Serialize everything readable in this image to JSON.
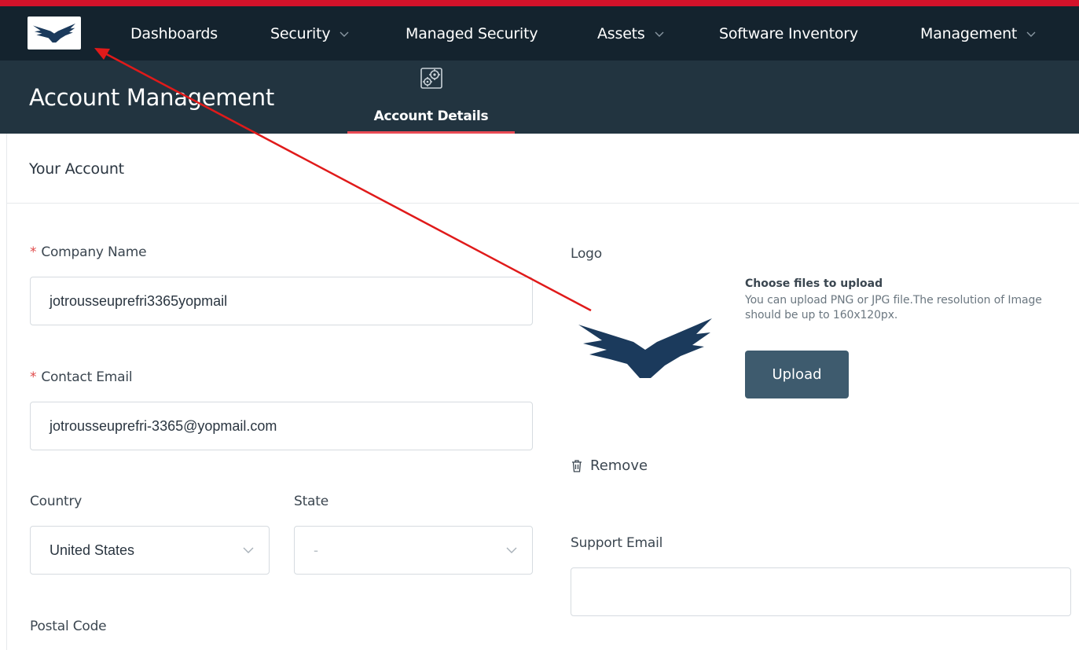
{
  "nav": {
    "items": [
      {
        "label": "Dashboards",
        "dropdown": false
      },
      {
        "label": "Security",
        "dropdown": true
      },
      {
        "label": "Managed Security",
        "dropdown": false
      },
      {
        "label": "Assets",
        "dropdown": true
      },
      {
        "label": "Software Inventory",
        "dropdown": false
      },
      {
        "label": "Management",
        "dropdown": true
      }
    ],
    "logo_icon": "eagle-logo-icon"
  },
  "subheader": {
    "title": "Account Management",
    "tab_label": "Account Details",
    "tab_icon": "settings-gears-icon"
  },
  "section": {
    "title": "Your Account"
  },
  "form": {
    "company_name": {
      "label": "Company Name",
      "required_mark": "*",
      "value": "jotrousseuprefri3365yopmail"
    },
    "contact_email": {
      "label": "Contact Email",
      "required_mark": "*",
      "value": "jotrousseuprefri-3365@yopmail.com"
    },
    "country": {
      "label": "Country",
      "value": "United States"
    },
    "state": {
      "label": "State",
      "value": "-"
    },
    "postal_code": {
      "label": "Postal Code"
    },
    "logo": {
      "label": "Logo"
    },
    "upload": {
      "title": "Choose files to upload",
      "description": "You can upload PNG or JPG file.The resolution of Image should be up to 160x120px.",
      "button_label": "Upload"
    },
    "remove_label": "Remove",
    "support_email": {
      "label": "Support Email",
      "value": ""
    }
  },
  "colors": {
    "accent_red": "#d3122a",
    "nav_bg": "#14232e",
    "subheader_bg": "#223440",
    "button_bg": "#3e5b6e",
    "logo_navy": "#1b3a5c"
  }
}
